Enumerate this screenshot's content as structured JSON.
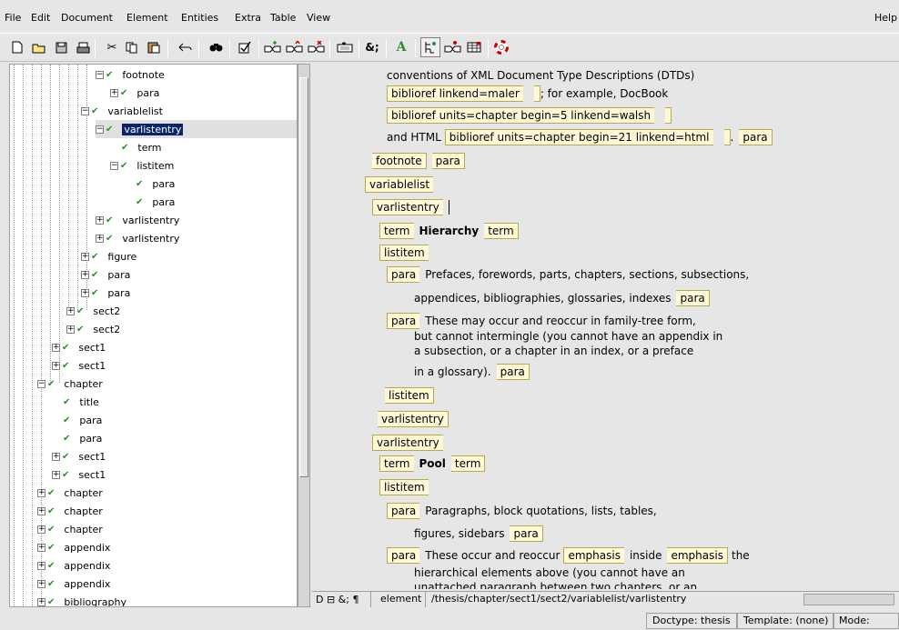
{
  "menubar": {
    "items": [
      "File",
      "Edit",
      "Document",
      "Element",
      "Entities",
      "Extra",
      "Table",
      "View"
    ],
    "help": "Help"
  },
  "toolbar": {
    "icons": [
      "new-document-icon",
      "open-folder-icon",
      "save-icon",
      "print-icon",
      "cut-icon",
      "copy-icon",
      "paste-icon",
      "undo-icon",
      "find-icon",
      "validate-icon",
      "insert-element-icon",
      "change-element-icon",
      "delete-element-icon",
      "attributes-icon",
      "entity-icon",
      "font-icon",
      "tree-view-icon",
      "element-view-icon",
      "table-icon",
      "help-lifebuoy-icon"
    ]
  },
  "tree": {
    "rows": [
      {
        "label": "footnote"
      },
      {
        "label": "para"
      },
      {
        "label": "variablelist"
      },
      {
        "label": "varlistentry"
      },
      {
        "label": "term"
      },
      {
        "label": "listitem"
      },
      {
        "label": "para"
      },
      {
        "label": "para"
      },
      {
        "label": "varlistentry"
      },
      {
        "label": "varlistentry"
      },
      {
        "label": "figure"
      },
      {
        "label": "para"
      },
      {
        "label": "para"
      },
      {
        "label": "sect2"
      },
      {
        "label": "sect2"
      },
      {
        "label": "sect1"
      },
      {
        "label": "sect1"
      },
      {
        "label": "chapter"
      },
      {
        "label": "title"
      },
      {
        "label": "para"
      },
      {
        "label": "para"
      },
      {
        "label": "sect1"
      },
      {
        "label": "sect1"
      },
      {
        "label": "chapter"
      },
      {
        "label": "chapter"
      },
      {
        "label": "chapter"
      },
      {
        "label": "appendix"
      },
      {
        "label": "appendix"
      },
      {
        "label": "appendix"
      },
      {
        "label": "bibliography"
      }
    ]
  },
  "editor": {
    "l1": "conventions of XML Document Type Descriptions (DTDs)",
    "l2_tag": "biblioref linkend=maler",
    "l2_text": "; for example, DocBook",
    "l3_tag": "biblioref units=chapter begin=5 linkend=walsh",
    "l4_text": "and HTML",
    "l4_tag": "biblioref units=chapter begin=21 linkend=html",
    "l4_dot": ".",
    "para": "para",
    "footnote": "footnote",
    "variablelist": "variablelist",
    "varlistentry": "varlistentry",
    "term": "term",
    "listitem": "listitem",
    "emphasis": "emphasis",
    "term1": "Hierarchy",
    "p1a": "Prefaces, forewords, parts, chapters, sections, subsections,",
    "p1b": "appendices, bibliographies, glossaries, indexes",
    "p2a": "These may occur and reoccur in family-tree form,",
    "p2b": "but cannot intermingle (you cannot have an appendix in",
    "p2c": "a subsection, or a chapter in an index, or a preface",
    "p2d": "in a glossary).",
    "term2": "Pool",
    "p3a": "Paragraphs, block quotations, lists, tables,",
    "p3b": "figures, sidebars",
    "p4a": "These occur and reoccur",
    "p4b": "inside",
    "p4c": "the",
    "p4d": "hierarchical elements above (you cannot have an",
    "p4e": "unattached paragraph between two chapters, or an"
  },
  "editor_status": {
    "mode_icons": "D ⊟ &; ¶",
    "element_label": "element",
    "path": "/thesis/chapter/sect1/sect2/variablelist/varlistentry"
  },
  "statusbar": {
    "doctype": "Doctype: thesis",
    "template": "Template: (none)",
    "mode": "Mode: XML"
  },
  "colors": {
    "tag_fill": "#fff8d6",
    "tag_border": "#b8a850",
    "selection": "#0a246a",
    "check": "#2e8b2e"
  }
}
